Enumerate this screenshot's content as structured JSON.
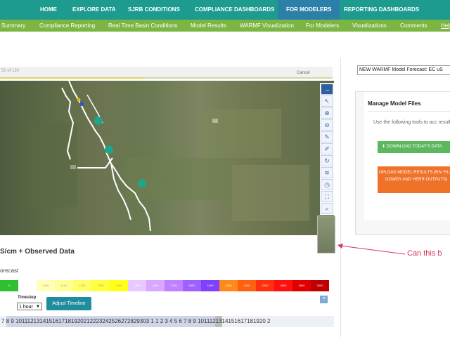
{
  "topnav": {
    "home": "HOME",
    "explore": "EXPLORE DATA",
    "sjrb": "SJRB CONDITIONS",
    "compliance": "COMPLIANCE DASHBOARDS",
    "modelers": "FOR MODELERS",
    "reporting": "REPORTING DASHBOARDS"
  },
  "subnav": {
    "summary": "Summary",
    "compliance_reporting": "Compliance Reporting",
    "realtime": "Real Time Basin Conditions",
    "model_results": "Model Results",
    "warmf": "WARMF Visualization",
    "for_modelers": "For Modelers",
    "visualizations": "Visualizations",
    "comments": "Comments",
    "help": "Help"
  },
  "loading": {
    "count_text": "52 of 120",
    "cancel_label": "Cancel",
    "progress": 0.433
  },
  "map": {
    "tools": [
      "arrow-right-icon",
      "pointer-icon",
      "zoom-in-icon",
      "zoom-out-icon",
      "pencil-icon",
      "edit-icon",
      "refresh-icon",
      "layers-icon",
      "clock-icon",
      "fullscreen-icon",
      "search-icon"
    ]
  },
  "legend": {
    "title": "S/cm + Observed Data",
    "forecast_label": "orecast",
    "scale": [
      {
        "label": "0",
        "color": "#2fbf2f"
      },
      {
        "label": "",
        "color": "#ffffff"
      },
      {
        "label": "1000",
        "color": "#ffffb8"
      },
      {
        "label": "1100",
        "color": "#ffff9a"
      },
      {
        "label": "1200",
        "color": "#ffff6a"
      },
      {
        "label": "1300",
        "color": "#ffff40"
      },
      {
        "label": "1400",
        "color": "#ffff1a"
      },
      {
        "label": "1500",
        "color": "#e8c8ff"
      },
      {
        "label": "1600",
        "color": "#d8a8ff"
      },
      {
        "label": "1700",
        "color": "#c080ff"
      },
      {
        "label": "1800",
        "color": "#a060ff"
      },
      {
        "label": "1900",
        "color": "#8040ff"
      },
      {
        "label": "2000",
        "color": "#ff8a1a"
      },
      {
        "label": "2200",
        "color": "#ff6010"
      },
      {
        "label": "2400",
        "color": "#ff3010"
      },
      {
        "label": "2600",
        "color": "#ff1010"
      },
      {
        "label": "2800",
        "color": "#e00000"
      },
      {
        "label": "3000",
        "color": "#c00000"
      }
    ]
  },
  "controls": {
    "timestep_label": "Timestep",
    "timestep_value": "1 hour",
    "adjust_label": "Adjust Timeline",
    "help_label": "?"
  },
  "timeline": {
    "text": "7 8 9 1011121314151617181920212223242526272829303 1 1 2 3 4 5 6 7 8 9 1011121314151617181920 2"
  },
  "right_panel": {
    "model_select": "NEW WARMF Model Forecast: EC uS",
    "title": "Manage Model Files",
    "description": "Use the following tools to acc results.",
    "download_label": "DOWNLOAD TODAY'S DATA",
    "upload_label": "UPLOAD MODEL RESULTS (RIV FILE, GOWDY AND HERR OUTPUTS)"
  },
  "annotation": {
    "text": "Can this b"
  },
  "colors": {
    "teal": "#1d9b8e",
    "active_nav": "#2c7fa8",
    "green": "#7cb542",
    "orange": "#f07128",
    "annotation": "#d63359"
  }
}
